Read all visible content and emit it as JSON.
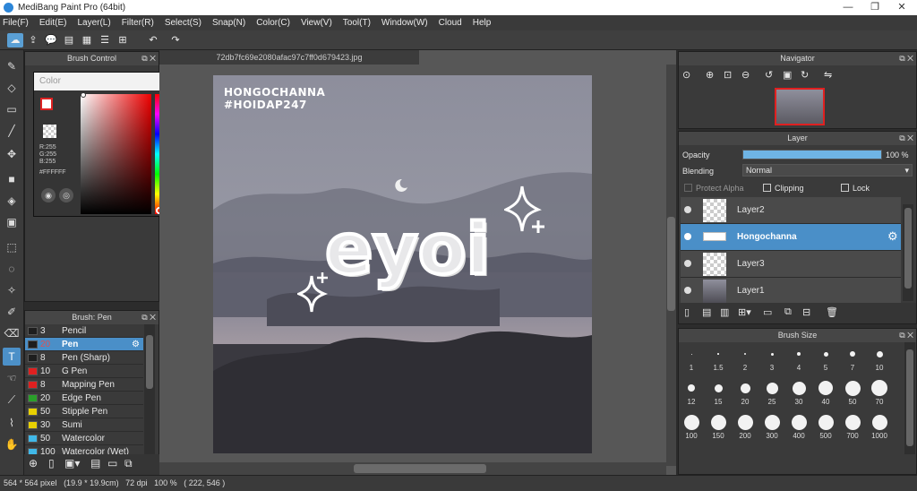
{
  "window": {
    "title": "MediBang Paint Pro (64bit)"
  },
  "menu": [
    "File(F)",
    "Edit(E)",
    "Layer(L)",
    "Filter(R)",
    "Select(S)",
    "Snap(N)",
    "Color(C)",
    "View(V)",
    "Tool(T)",
    "Window(W)",
    "Cloud",
    "Help"
  ],
  "brush_control": {
    "title": "Brush Control"
  },
  "color_panel": {
    "title": "Color",
    "rgb_r": "R:255",
    "rgb_g": "G:255",
    "rgb_b": "B:255",
    "hex": "#FFFFFF"
  },
  "canvas": {
    "tab": "72db7fc69e2080afac97c7ff0d679423.jpg",
    "text_line1": "HONGOCHANNA",
    "text_line2": "#HOIDAP247",
    "center_text": "eyoi"
  },
  "brush_panel": {
    "title": "Brush: Pen",
    "items": [
      {
        "size": "3",
        "name": "Pencil",
        "color": "#1e1e1e"
      },
      {
        "size": "20",
        "name": "Pen",
        "color": "#1e1e1e"
      },
      {
        "size": "8",
        "name": "Pen (Sharp)",
        "color": "#1e1e1e"
      },
      {
        "size": "10",
        "name": "G Pen",
        "color": "#e02020"
      },
      {
        "size": "8",
        "name": "Mapping Pen",
        "color": "#e02020"
      },
      {
        "size": "20",
        "name": "Edge Pen",
        "color": "#2aa02a"
      },
      {
        "size": "50",
        "name": "Stipple Pen",
        "color": "#e8d000"
      },
      {
        "size": "30",
        "name": "Sumi",
        "color": "#e8d000"
      },
      {
        "size": "50",
        "name": "Watercolor",
        "color": "#40b8e8"
      },
      {
        "size": "100",
        "name": "Watercolor (Wet)",
        "color": "#40b8e8"
      }
    ]
  },
  "navigator": {
    "title": "Navigator"
  },
  "layer_panel": {
    "title": "Layer",
    "opacity_label": "Opacity",
    "opacity_value": "100 %",
    "opacity_level": 1.0,
    "blending_label": "Blending",
    "blending_value": "Normal",
    "protect_alpha": "Protect Alpha",
    "clipping": "Clipping",
    "lock": "Lock",
    "layers": [
      "Layer2",
      "Hongochanna",
      "Layer3",
      "Layer1"
    ]
  },
  "brush_size": {
    "title": "Brush Size",
    "sizes": [
      "1",
      "1.5",
      "2",
      "3",
      "4",
      "5",
      "7",
      "10",
      "12",
      "15",
      "20",
      "25",
      "30",
      "40",
      "50",
      "70",
      "100",
      "150",
      "200",
      "300",
      "400",
      "500",
      "700",
      "1000"
    ]
  },
  "status": {
    "dimensions": "564 * 564 pixel",
    "cm": "(19.9 * 19.9cm)",
    "dpi": "72 dpi",
    "zoom": "100 %",
    "coords": "( 222, 546 )"
  },
  "colors": {
    "accent": "#4a8fc8",
    "panel": "#3a3a3a"
  }
}
